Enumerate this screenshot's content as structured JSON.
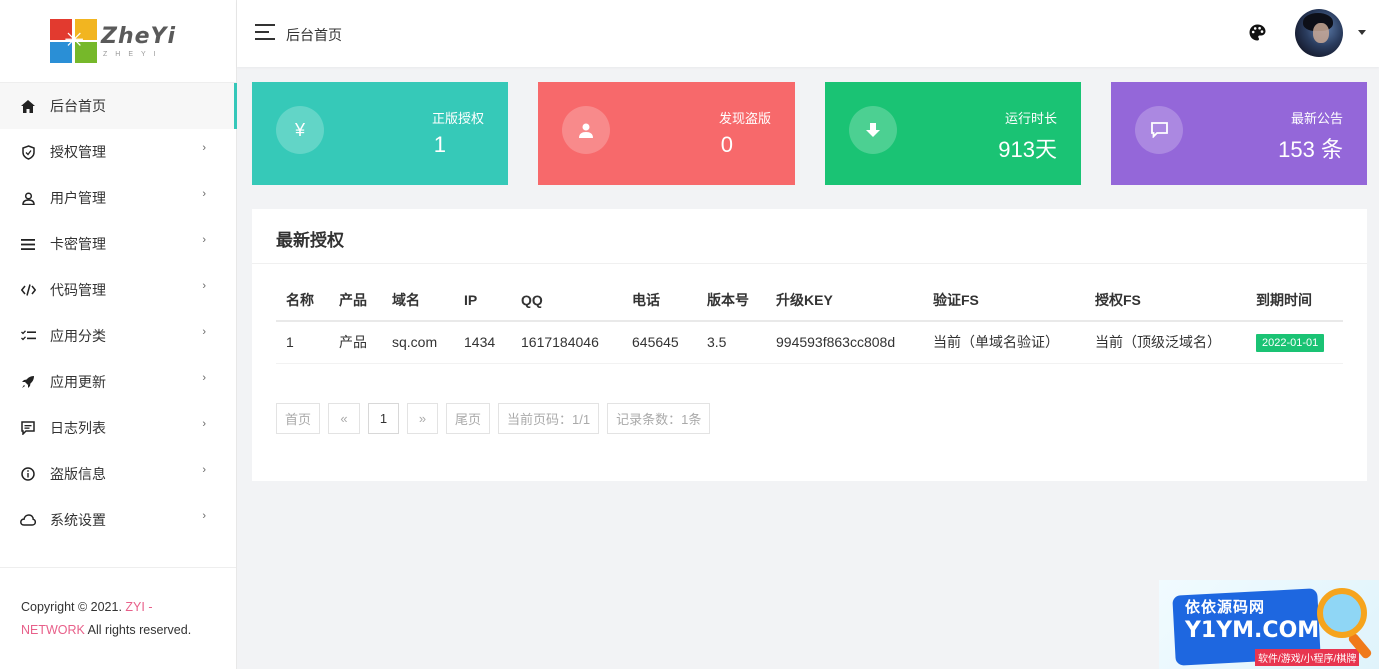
{
  "logo": {
    "word": "ZheYi",
    "sub": "ZHEYI"
  },
  "sidebar": {
    "items": [
      {
        "label": "后台首页",
        "icon": "home-icon",
        "active": true,
        "has_children": false
      },
      {
        "label": "授权管理",
        "icon": "shield-icon",
        "active": false,
        "has_children": true
      },
      {
        "label": "用户管理",
        "icon": "user-icon",
        "active": false,
        "has_children": true
      },
      {
        "label": "卡密管理",
        "icon": "list-icon",
        "active": false,
        "has_children": true
      },
      {
        "label": "代码管理",
        "icon": "code-icon",
        "active": false,
        "has_children": true
      },
      {
        "label": "应用分类",
        "icon": "checklist-icon",
        "active": false,
        "has_children": true
      },
      {
        "label": "应用更新",
        "icon": "rocket-icon",
        "active": false,
        "has_children": true
      },
      {
        "label": "日志列表",
        "icon": "comment-icon",
        "active": false,
        "has_children": true
      },
      {
        "label": "盗版信息",
        "icon": "info-icon",
        "active": false,
        "has_children": true
      },
      {
        "label": "系统设置",
        "icon": "cloud-icon",
        "active": false,
        "has_children": true
      }
    ],
    "footer": {
      "copyright": "Copyright © 2021. ",
      "brand": "ZYI - NETWORK",
      "rights": " All rights reserved."
    }
  },
  "header": {
    "breadcrumb": "后台首页"
  },
  "stats": [
    {
      "label": "正版授权",
      "value": "1",
      "icon": "yen-icon",
      "color": "#36c9b8"
    },
    {
      "label": "发现盗版",
      "value": "0",
      "icon": "user-icon",
      "color": "#f7696b"
    },
    {
      "label": "运行时长",
      "value": "913天",
      "icon": "download-icon",
      "color": "#1ac374"
    },
    {
      "label": "最新公告",
      "value": "153 条",
      "icon": "message-icon",
      "color": "#9467d9"
    }
  ],
  "panel": {
    "title": "最新授权",
    "columns": [
      "名称",
      "产品",
      "域名",
      "IP",
      "QQ",
      "电话",
      "版本号",
      "升级KEY",
      "验证FS",
      "授权FS",
      "到期时间"
    ],
    "rows": [
      [
        "1",
        "产品",
        "sq.com",
        "1434",
        "1617184046",
        "645645",
        "3.5",
        "994593f863cc808d",
        "当前（单域名验证）",
        "当前（顶级泛域名）",
        "2022-01-01"
      ]
    ]
  },
  "pager": {
    "first": "首页",
    "prev": "«",
    "current": "1",
    "next": "»",
    "last": "尾页",
    "page_info": "当前页码：1/1",
    "record_info": "记录条数：1条"
  },
  "watermark": {
    "line1": "依依源码网",
    "line2": "Y1YM.COM",
    "line3": "软件/游戏/小程序/棋牌"
  }
}
